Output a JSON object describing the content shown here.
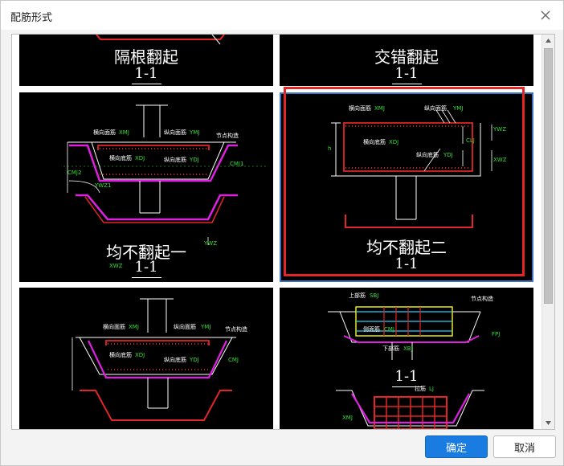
{
  "dialog": {
    "title": "配筋形式",
    "ok_label": "确定",
    "cancel_label": "取消"
  },
  "tiles": [
    {
      "caption": "隔根翻起",
      "section": "1-1"
    },
    {
      "caption": "交错翻起",
      "section": "1-1"
    },
    {
      "caption": "均不翻起一",
      "section": "1-1",
      "labels": [
        "横向面筋",
        "XMJ",
        "纵向面筋",
        "YMJ",
        "横向底筋",
        "XDJ",
        "纵向底筋",
        "YDJ",
        "CMJ2",
        "CMJ1",
        "XWZ",
        "YWZ",
        "节点构造",
        "YWZ1"
      ]
    },
    {
      "caption": "均不翻起二",
      "section": "1-1",
      "labels": [
        "横向面筋",
        "XMJ",
        "纵向面筋",
        "YMJ",
        "横向底筋",
        "XDJ",
        "纵向底筋",
        "YDJ",
        "CLJ",
        "YWZ",
        "XWZ",
        "h"
      ]
    },
    {
      "caption": "",
      "section": "",
      "labels": [
        "横向面筋",
        "XMJ",
        "纵向面筋",
        "YMJ",
        "横向底筋",
        "XDJ",
        "纵向底筋",
        "YDJ",
        "CMJ",
        "节点构造"
      ]
    },
    {
      "caption": "",
      "section": "1-1",
      "labels": [
        "上部筋",
        "SBJ",
        "侧面筋",
        "CMJ",
        "下部筋",
        "XBJ",
        "节点构造",
        "FPJ",
        "XMJ",
        "拉筋",
        "LJ"
      ]
    }
  ],
  "colors": {
    "selection_outline": "#e32525",
    "accent_button": "#1a7ce0",
    "rebar_red": "#e32525",
    "magenta": "#e020e0",
    "green_text": "#34e034"
  }
}
